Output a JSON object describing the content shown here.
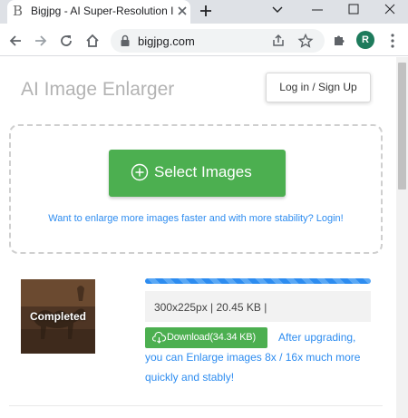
{
  "browser": {
    "tab_title": "Bigjpg - AI Super-Resolution I",
    "tab_favicon": "B",
    "url": "bigjpg.com",
    "profile_initial": "R",
    "profile_color": "#1e7b5c"
  },
  "header": {
    "site_title": "AI Image Enlarger",
    "login_label": "Log in / Sign Up"
  },
  "dropzone": {
    "select_label": "Select Images",
    "login_prompt": "Want to enlarge more images faster and with more stability? Login!"
  },
  "job": {
    "status": "Completed",
    "progress_percent": 100,
    "info": "300x225px | 20.45 KB |",
    "download_label": "Download(34.34 KB)",
    "upgrade_line1": "After upgrading,",
    "upgrade_line2": "you can Enlarge images 8x / 16x much more",
    "upgrade_line3": "quickly and stably!"
  },
  "colors": {
    "accent_green": "#4caf50",
    "link_blue": "#2d8cf0"
  }
}
